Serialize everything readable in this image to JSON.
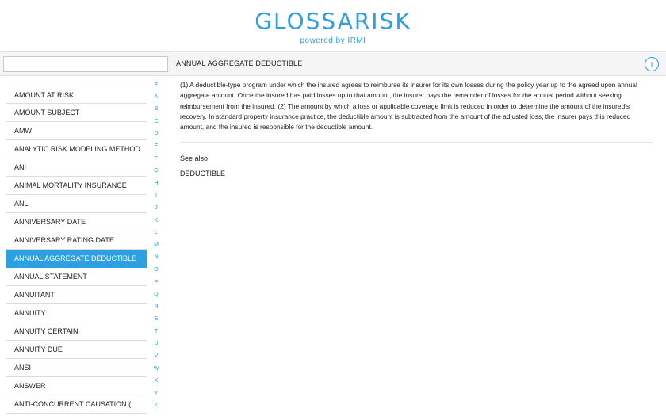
{
  "header": {
    "logo": "GLOSSARISK",
    "tagline": "powered by IRMI"
  },
  "search": {
    "value": "",
    "placeholder": ""
  },
  "term": {
    "title": "ANNUAL AGGREGATE DEDUCTIBLE",
    "definition": "(1) A deductible-type program under which the insured agrees to reimburse its insurer for its own losses during the policy year up to the agreed upon annual aggregate amount. Once the insured has paid losses up to that amount, the insurer pays the remainder of losses for the annual period without seeking reimbursement from the insured. (2) The amount by which a loss or applicable coverage limit is reduced in order to determine the amount of the insured's recovery. In standard property insurance practice, the deductible amount is subtracted from the amount of the adjusted loss; the insurer pays this reduced amount, and the insured is responsible for the deductible amount.",
    "see_also_label": "See also",
    "see_also_link": "DEDUCTIBLE"
  },
  "info_icon": "info-icon",
  "terms": [
    "AMOUNT AT RISK",
    "AMOUNT SUBJECT",
    "AMW",
    "ANALYTIC RISK MODELING METHOD",
    "ANI",
    "ANIMAL MORTALITY INSURANCE",
    "ANL",
    "ANNIVERSARY DATE",
    "ANNIVERSARY RATING DATE",
    "ANNUAL AGGREGATE DEDUCTIBLE",
    "ANNUAL STATEMENT",
    "ANNUITANT",
    "ANNUITY",
    "ANNUITY CERTAIN",
    "ANNUITY DUE",
    "ANSI",
    "ANSWER",
    "ANTI-CONCURRENT CAUSATION (..."
  ],
  "active_term_index": 9,
  "alphabet": [
    "#",
    "A",
    "B",
    "C",
    "D",
    "E",
    "F",
    "G",
    "H",
    "I",
    "J",
    "K",
    "L",
    "M",
    "N",
    "O",
    "P",
    "Q",
    "R",
    "S",
    "T",
    "U",
    "V",
    "W",
    "X",
    "Y",
    "Z"
  ],
  "colors": {
    "accent": "#2d9fe3"
  }
}
